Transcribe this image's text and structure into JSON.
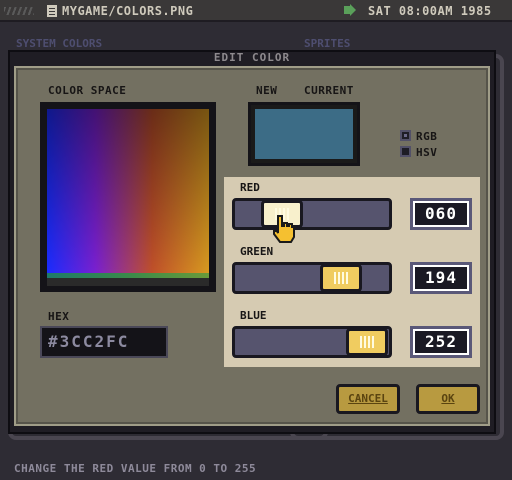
{
  "topbar": {
    "filename": "MYGAME/COLORS.PNG",
    "clock": "SAT 08:00AM 1985",
    "icons": [
      "menu-stripes",
      "file-icon",
      "speaker-icon"
    ]
  },
  "background_app": {
    "left_panel_label": "SYSTEM COLORS",
    "right_panel_label": "SPRITES"
  },
  "dialog": {
    "title": "EDIT COLOR",
    "color_space_label": "COLOR SPACE",
    "new_label": "NEW",
    "current_label": "CURRENT",
    "preview_color": "#3C6C86",
    "modes": [
      {
        "label": "RGB",
        "selected": true
      },
      {
        "label": "HSV",
        "selected": false
      }
    ],
    "hex_label": "HEX",
    "hex_value": "#3CC2FC",
    "sliders": [
      {
        "label": "RED",
        "value": "060",
        "level": 0.235,
        "active": true
      },
      {
        "label": "GREEN",
        "value": "194",
        "level": 0.761,
        "active": false
      },
      {
        "label": "BLUE",
        "value": "252",
        "level": 0.988,
        "active": false
      }
    ],
    "cancel_label": "CANCEL",
    "ok_label": "OK"
  },
  "status_bar": {
    "text": "CHANGE THE RED VALUE FROM 0 TO 255"
  },
  "colors": {
    "dialog_body": "#737061",
    "slider_panel": "#D6CBB2",
    "button": "#B89A40",
    "thumb": "#F0CC60"
  }
}
